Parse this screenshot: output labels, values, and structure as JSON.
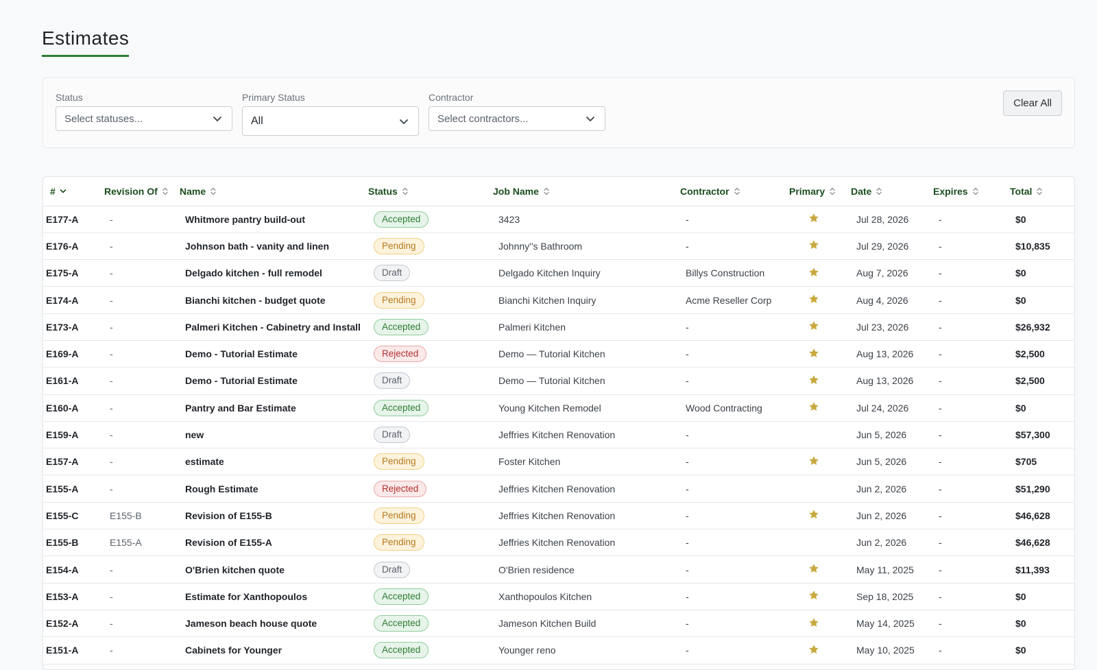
{
  "page": {
    "title": "Estimates"
  },
  "colors": {
    "accent": "#2e7d32",
    "star": "#c9a93f"
  },
  "filters": {
    "status": {
      "label": "Status",
      "placeholder": "Select statuses..."
    },
    "primary_status": {
      "label": "Primary Status",
      "value": "All"
    },
    "contractor": {
      "label": "Contractor",
      "placeholder": "Select contractors..."
    },
    "clear_label": "Clear All"
  },
  "table": {
    "columns": [
      "#",
      "Revision Of",
      "Name",
      "Status",
      "Job Name",
      "Contractor",
      "Primary",
      "Date",
      "Expires",
      "Total"
    ],
    "rows": [
      {
        "id": "E177-A",
        "rev": "-",
        "name": "Whitmore pantry build-out",
        "status": "Accepted",
        "job": "3423",
        "contractor": "-",
        "primary": true,
        "date": "Jul 28, 2026",
        "expires": "-",
        "total": "$0"
      },
      {
        "id": "E176-A",
        "rev": "-",
        "name": "Johnson bath - vanity and linen",
        "status": "Pending",
        "job": "Johnny''s Bathroom",
        "contractor": "-",
        "primary": true,
        "date": "Jul 29, 2026",
        "expires": "-",
        "total": "$10,835"
      },
      {
        "id": "E175-A",
        "rev": "-",
        "name": "Delgado kitchen - full remodel",
        "status": "Draft",
        "job": "Delgado Kitchen Inquiry",
        "contractor": "Billys Construction",
        "primary": true,
        "date": "Aug 7, 2026",
        "expires": "-",
        "total": "$0"
      },
      {
        "id": "E174-A",
        "rev": "-",
        "name": "Bianchi kitchen - budget quote",
        "status": "Pending",
        "job": "Bianchi Kitchen Inquiry",
        "contractor": "Acme Reseller Corp",
        "primary": true,
        "date": "Aug 4, 2026",
        "expires": "-",
        "total": "$0"
      },
      {
        "id": "E173-A",
        "rev": "-",
        "name": "Palmeri Kitchen - Cabinetry and Install",
        "status": "Accepted",
        "job": "Palmeri Kitchen",
        "contractor": "-",
        "primary": true,
        "date": "Jul 23, 2026",
        "expires": "-",
        "total": "$26,932"
      },
      {
        "id": "E169-A",
        "rev": "-",
        "name": "Demo - Tutorial Estimate",
        "status": "Rejected",
        "job": "Demo — Tutorial Kitchen",
        "contractor": "-",
        "primary": true,
        "date": "Aug 13, 2026",
        "expires": "-",
        "total": "$2,500"
      },
      {
        "id": "E161-A",
        "rev": "-",
        "name": "Demo - Tutorial Estimate",
        "status": "Draft",
        "job": "Demo — Tutorial Kitchen",
        "contractor": "-",
        "primary": true,
        "date": "Aug 13, 2026",
        "expires": "-",
        "total": "$2,500"
      },
      {
        "id": "E160-A",
        "rev": "-",
        "name": "Pantry and Bar Estimate",
        "status": "Accepted",
        "job": "Young Kitchen Remodel",
        "contractor": "Wood Contracting",
        "primary": true,
        "date": "Jul 24, 2026",
        "expires": "-",
        "total": "$0"
      },
      {
        "id": "E159-A",
        "rev": "-",
        "name": "new",
        "status": "Draft",
        "job": "Jeffries Kitchen Renovation",
        "contractor": "-",
        "primary": false,
        "date": "Jun 5, 2026",
        "expires": "-",
        "total": "$57,300"
      },
      {
        "id": "E157-A",
        "rev": "-",
        "name": "estimate",
        "status": "Pending",
        "job": "Foster Kitchen",
        "contractor": "-",
        "primary": true,
        "date": "Jun 5, 2026",
        "expires": "-",
        "total": "$705"
      },
      {
        "id": "E155-A",
        "rev": "-",
        "name": "Rough Estimate",
        "status": "Rejected",
        "job": "Jeffries Kitchen Renovation",
        "contractor": "-",
        "primary": false,
        "date": "Jun 2, 2026",
        "expires": "-",
        "total": "$51,290"
      },
      {
        "id": "E155-C",
        "rev": "E155-B",
        "name": "Revision of E155-B",
        "status": "Pending",
        "job": "Jeffries Kitchen Renovation",
        "contractor": "-",
        "primary": true,
        "date": "Jun 2, 2026",
        "expires": "-",
        "total": "$46,628"
      },
      {
        "id": "E155-B",
        "rev": "E155-A",
        "name": "Revision of E155-A",
        "status": "Pending",
        "job": "Jeffries Kitchen Renovation",
        "contractor": "-",
        "primary": false,
        "date": "Jun 2, 2026",
        "expires": "-",
        "total": "$46,628"
      },
      {
        "id": "E154-A",
        "rev": "-",
        "name": "O'Brien kitchen quote",
        "status": "Draft",
        "job": "O'Brien residence",
        "contractor": "-",
        "primary": true,
        "date": "May 11, 2025",
        "expires": "-",
        "total": "$11,393"
      },
      {
        "id": "E153-A",
        "rev": "-",
        "name": "Estimate for Xanthopoulos",
        "status": "Accepted",
        "job": "Xanthopoulos Kitchen",
        "contractor": "-",
        "primary": true,
        "date": "Sep 18, 2025",
        "expires": "-",
        "total": "$0"
      },
      {
        "id": "E152-A",
        "rev": "-",
        "name": "Jameson beach house quote",
        "status": "Accepted",
        "job": "Jameson Kitchen Build",
        "contractor": "-",
        "primary": true,
        "date": "May 14, 2025",
        "expires": "-",
        "total": "$0"
      },
      {
        "id": "E151-A",
        "rev": "-",
        "name": "Cabinets for Younger",
        "status": "Accepted",
        "job": "Younger reno",
        "contractor": "-",
        "primary": true,
        "date": "May 10, 2025",
        "expires": "-",
        "total": "$0"
      }
    ]
  }
}
